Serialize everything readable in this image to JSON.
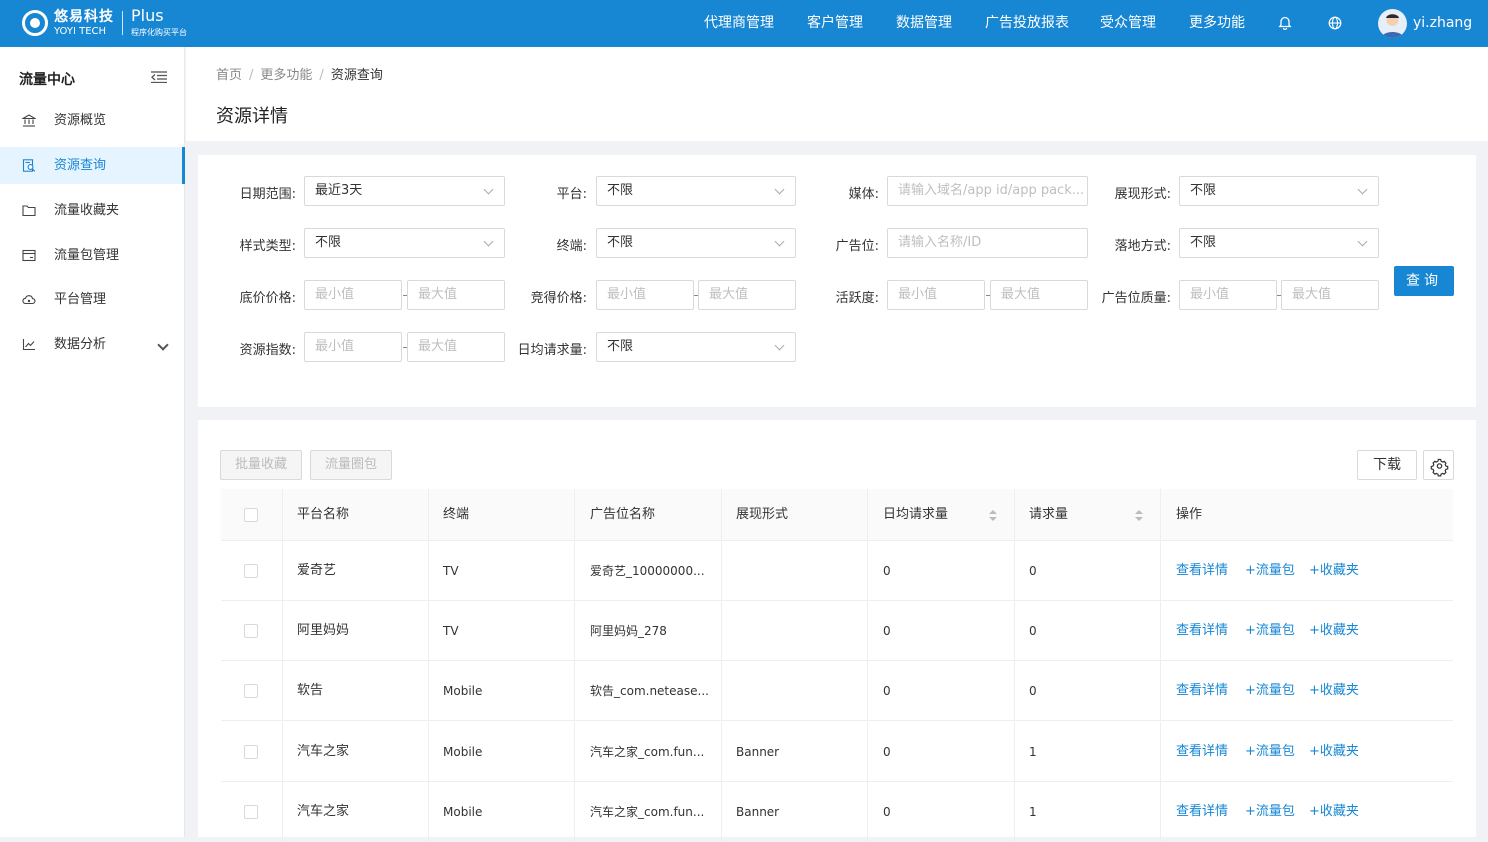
{
  "brand": {
    "name_cn": "悠易科技",
    "name_en": "YOYI TECH",
    "product": "Plus",
    "tagline": "程序化购买平台"
  },
  "topnav": {
    "items": [
      "代理商管理",
      "客户管理",
      "数据管理",
      "广告投放报表",
      "受众管理",
      "更多功能"
    ],
    "username": "yi.zhang"
  },
  "sidebar": {
    "title": "流量中心",
    "items": [
      {
        "label": "资源概览",
        "icon": "bank-icon"
      },
      {
        "label": "资源查询",
        "icon": "search-doc-icon"
      },
      {
        "label": "流量收藏夹",
        "icon": "folder-icon"
      },
      {
        "label": "流量包管理",
        "icon": "card-icon"
      },
      {
        "label": "平台管理",
        "icon": "cloud-icon"
      },
      {
        "label": "数据分析",
        "icon": "line-chart-icon"
      }
    ]
  },
  "breadcrumb": [
    "首页",
    "更多功能",
    "资源查询"
  ],
  "page_title": "资源详情",
  "filters": {
    "date_range": {
      "label": "日期范围:",
      "value": "最近3天"
    },
    "platform": {
      "label": "平台:",
      "value": "不限"
    },
    "media": {
      "label": "媒体:",
      "placeholder": "请输入域名/app id/app pack..."
    },
    "display_form": {
      "label": "展现形式:",
      "value": "不限"
    },
    "style_type": {
      "label": "样式类型:",
      "value": "不限"
    },
    "terminal": {
      "label": "终端:",
      "value": "不限"
    },
    "ad_slot": {
      "label": "广告位:",
      "placeholder": "请输入名称/ID"
    },
    "landing": {
      "label": "落地方式:",
      "value": "不限"
    },
    "floor_price": {
      "label": "底价价格:"
    },
    "win_price": {
      "label": "竞得价格:"
    },
    "activity": {
      "label": "活跃度:"
    },
    "slot_quality": {
      "label": "广告位质量:"
    },
    "resource_index": {
      "label": "资源指数:"
    },
    "daily_requests": {
      "label": "日均请求量:",
      "value": "不限"
    },
    "min_placeholder": "最小值",
    "max_placeholder": "最大值",
    "query_button": "查询"
  },
  "toolbar": {
    "batch_fav": "批量收藏",
    "traffic_pack": "流量圈包",
    "download": "下载"
  },
  "table": {
    "headers": [
      "平台名称",
      "终端",
      "广告位名称",
      "展现形式",
      "日均请求量",
      "请求量",
      "操作"
    ],
    "rows": [
      {
        "platform": "爱奇艺",
        "terminal": "TV",
        "slot": "爱奇艺_10000000...",
        "form": "",
        "daily": "0",
        "requests": "0"
      },
      {
        "platform": "阿里妈妈",
        "terminal": "TV",
        "slot": "阿里妈妈_278",
        "form": "",
        "daily": "0",
        "requests": "0"
      },
      {
        "platform": "软告",
        "terminal": "Mobile",
        "slot": "软告_com.netease...",
        "form": "",
        "daily": "0",
        "requests": "0"
      },
      {
        "platform": "汽车之家",
        "terminal": "Mobile",
        "slot": "汽车之家_com.fun...",
        "form": "Banner",
        "daily": "0",
        "requests": "1"
      },
      {
        "platform": "汽车之家",
        "terminal": "Mobile",
        "slot": "汽车之家_com.fun...",
        "form": "Banner",
        "daily": "0",
        "requests": "1"
      }
    ],
    "actions": {
      "detail": "查看详情",
      "pack": "+流量包",
      "fav": "+收藏夹"
    }
  }
}
